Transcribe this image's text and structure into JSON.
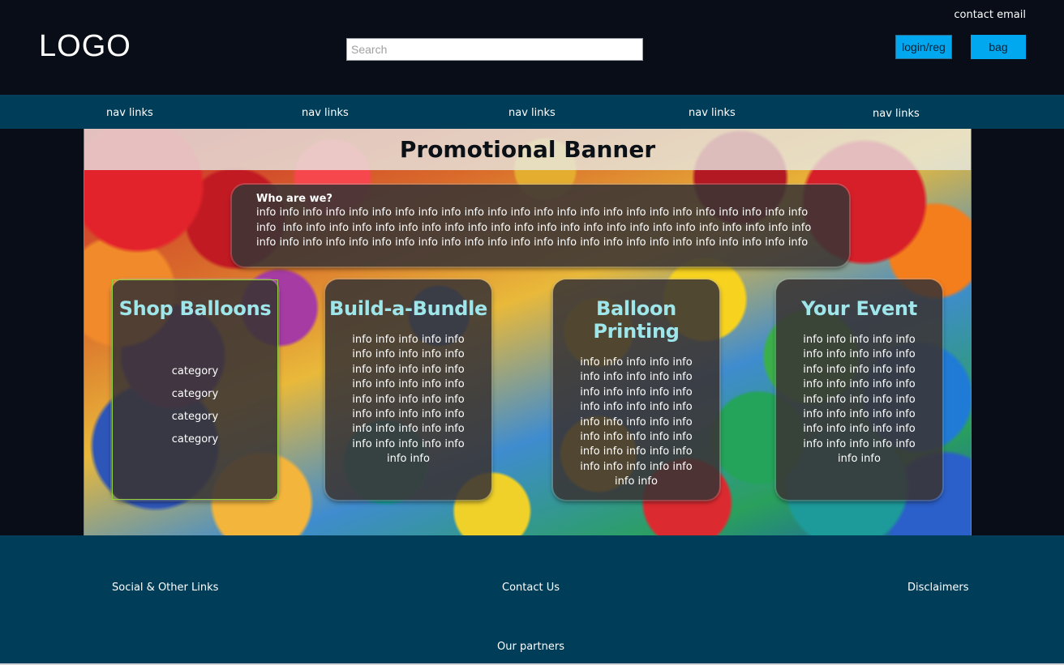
{
  "header": {
    "logo": "LOGO",
    "contact_email": "contact email",
    "search_placeholder": "Search",
    "login_label": "login/reg",
    "bag_label": "bag"
  },
  "nav": {
    "links": [
      "nav links",
      "nav links",
      "nav links",
      "nav links",
      "nav links"
    ]
  },
  "promo": {
    "title": "Promotional Banner"
  },
  "about": {
    "title": "Who are we?",
    "line1": "info info info info info info info info info info info info info info info info info info info info info info info info",
    "line2": "info  info info info info info info info info info info info info info info info info info info info info info info info",
    "line3": "info info info info info info info info info info info info info info info info info info info info info info info info"
  },
  "cards": [
    {
      "title": "Shop Balloons",
      "categories": [
        "category",
        "category",
        "category",
        "category"
      ]
    },
    {
      "title": "Build-a-Bundle",
      "info": "info info info info info info info info info info info info info info info info info info info info info info info info info info info info info info info info info info info info info info info info info info"
    },
    {
      "title": "Balloon Printing",
      "info": "info info info info info info info info info info info info info info info info info info info info info info info info info info info info info info info info info info info info info info info info info info"
    },
    {
      "title": "Your Event",
      "info": "info info info info info info info info info info info info info info info info info info info info info info info info info info info info info info info info info info info info info info info info info info"
    }
  ],
  "footer": {
    "social": "Social & Other Links",
    "contact": "Contact Us",
    "disclaimers": "Disclaimers",
    "partners": "Our partners"
  },
  "colors": {
    "header_bg": "#080d17",
    "nav_bg": "#003d58",
    "button_bg": "#02a8ef",
    "card_title": "#9fe6ea",
    "card_bg": "#3a3434"
  }
}
